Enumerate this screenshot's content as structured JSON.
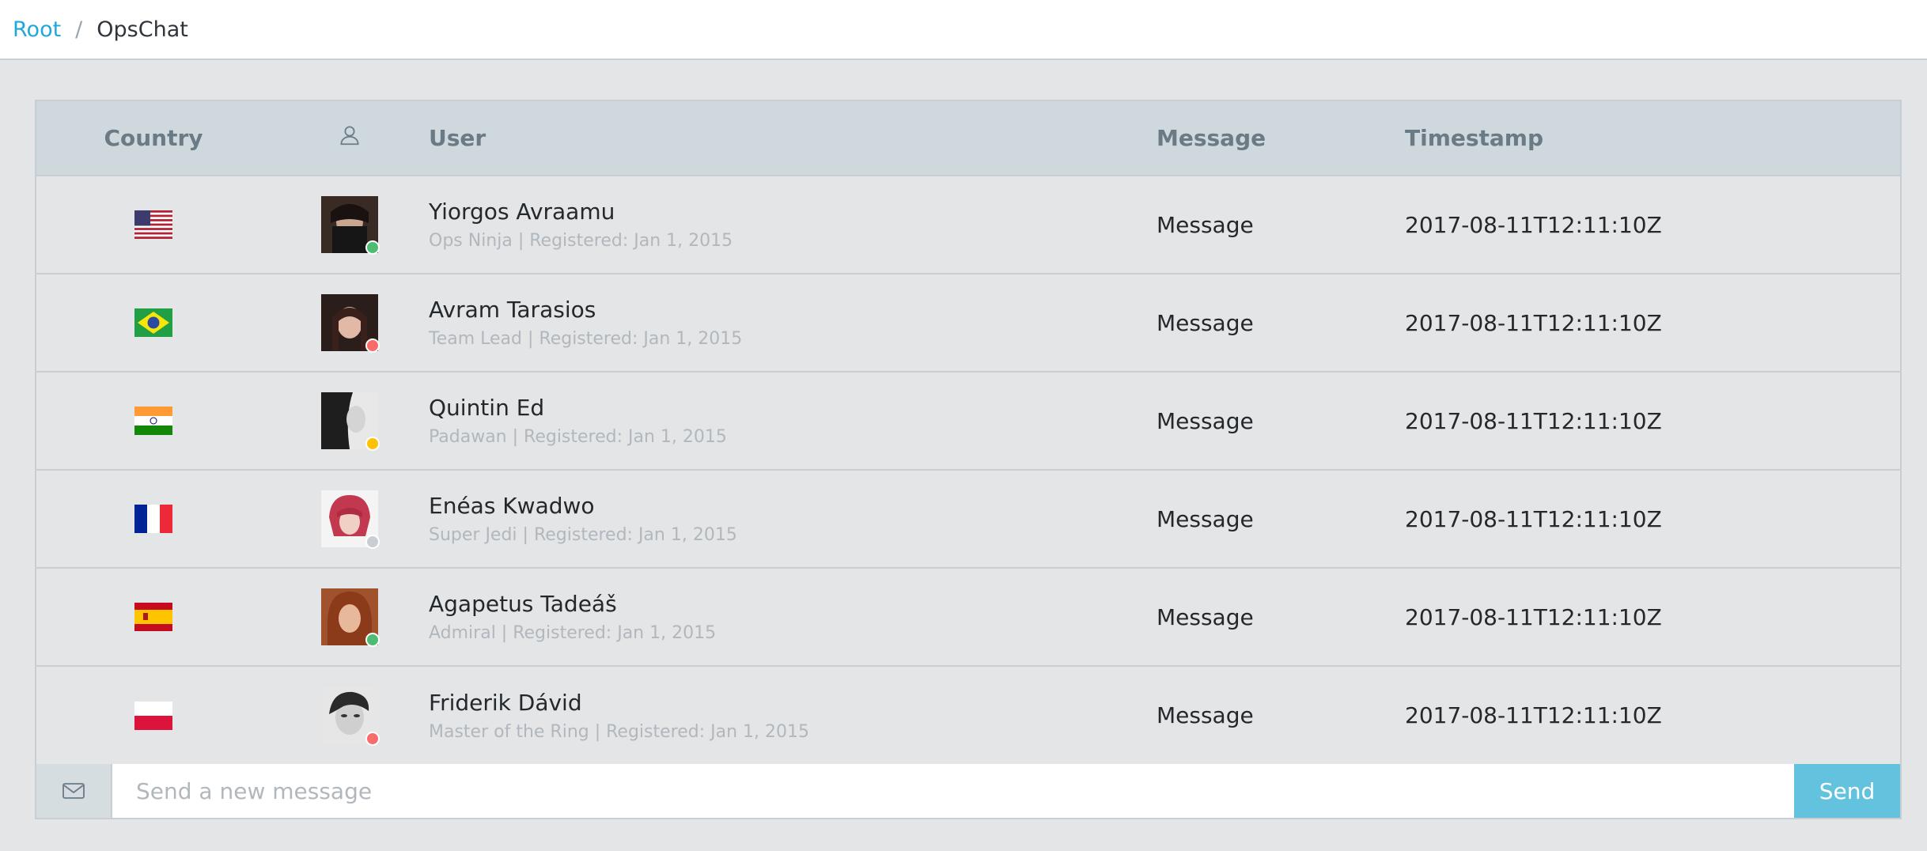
{
  "breadcrumb": {
    "root": "Root",
    "separator": "/",
    "current": "OpsChat"
  },
  "table": {
    "headers": {
      "country": "Country",
      "avatar_icon": "user-icon",
      "user": "User",
      "message": "Message",
      "timestamp": "Timestamp"
    },
    "rows": [
      {
        "flag": "us-flag-icon",
        "name": "Yiorgos Avraamu",
        "meta": "Ops Ninja | Registered: Jan 1, 2015",
        "message": "Message",
        "timestamp": "2017-08-11T12:11:10Z",
        "status": "online",
        "status_color": "#4dbd74"
      },
      {
        "flag": "br-flag-icon",
        "name": "Avram Tarasios",
        "meta": "Team Lead | Registered: Jan 1, 2015",
        "message": "Message",
        "timestamp": "2017-08-11T12:11:10Z",
        "status": "busy",
        "status_color": "#f86c6b"
      },
      {
        "flag": "in-flag-icon",
        "name": "Quintin Ed",
        "meta": "Padawan | Registered: Jan 1, 2015",
        "message": "Message",
        "timestamp": "2017-08-11T12:11:10Z",
        "status": "away",
        "status_color": "#ffc107"
      },
      {
        "flag": "fr-flag-icon",
        "name": "Enéas Kwadwo",
        "meta": "Super Jedi | Registered: Jan 1, 2015",
        "message": "Message",
        "timestamp": "2017-08-11T12:11:10Z",
        "status": "offline",
        "status_color": "#c8ced3"
      },
      {
        "flag": "es-flag-icon",
        "name": "Agapetus Tadeáš",
        "meta": "Admiral | Registered: Jan 1, 2015",
        "message": "Message",
        "timestamp": "2017-08-11T12:11:10Z",
        "status": "online",
        "status_color": "#4dbd74"
      },
      {
        "flag": "pl-flag-icon",
        "name": "Friderik Dávid",
        "meta": "Master of the Ring | Registered: Jan 1, 2015",
        "message": "Message",
        "timestamp": "2017-08-11T12:11:10Z",
        "status": "busy",
        "status_color": "#f86c6b"
      }
    ]
  },
  "composer": {
    "icon": "envelope-icon",
    "placeholder": "Send a new message",
    "send_label": "Send"
  }
}
